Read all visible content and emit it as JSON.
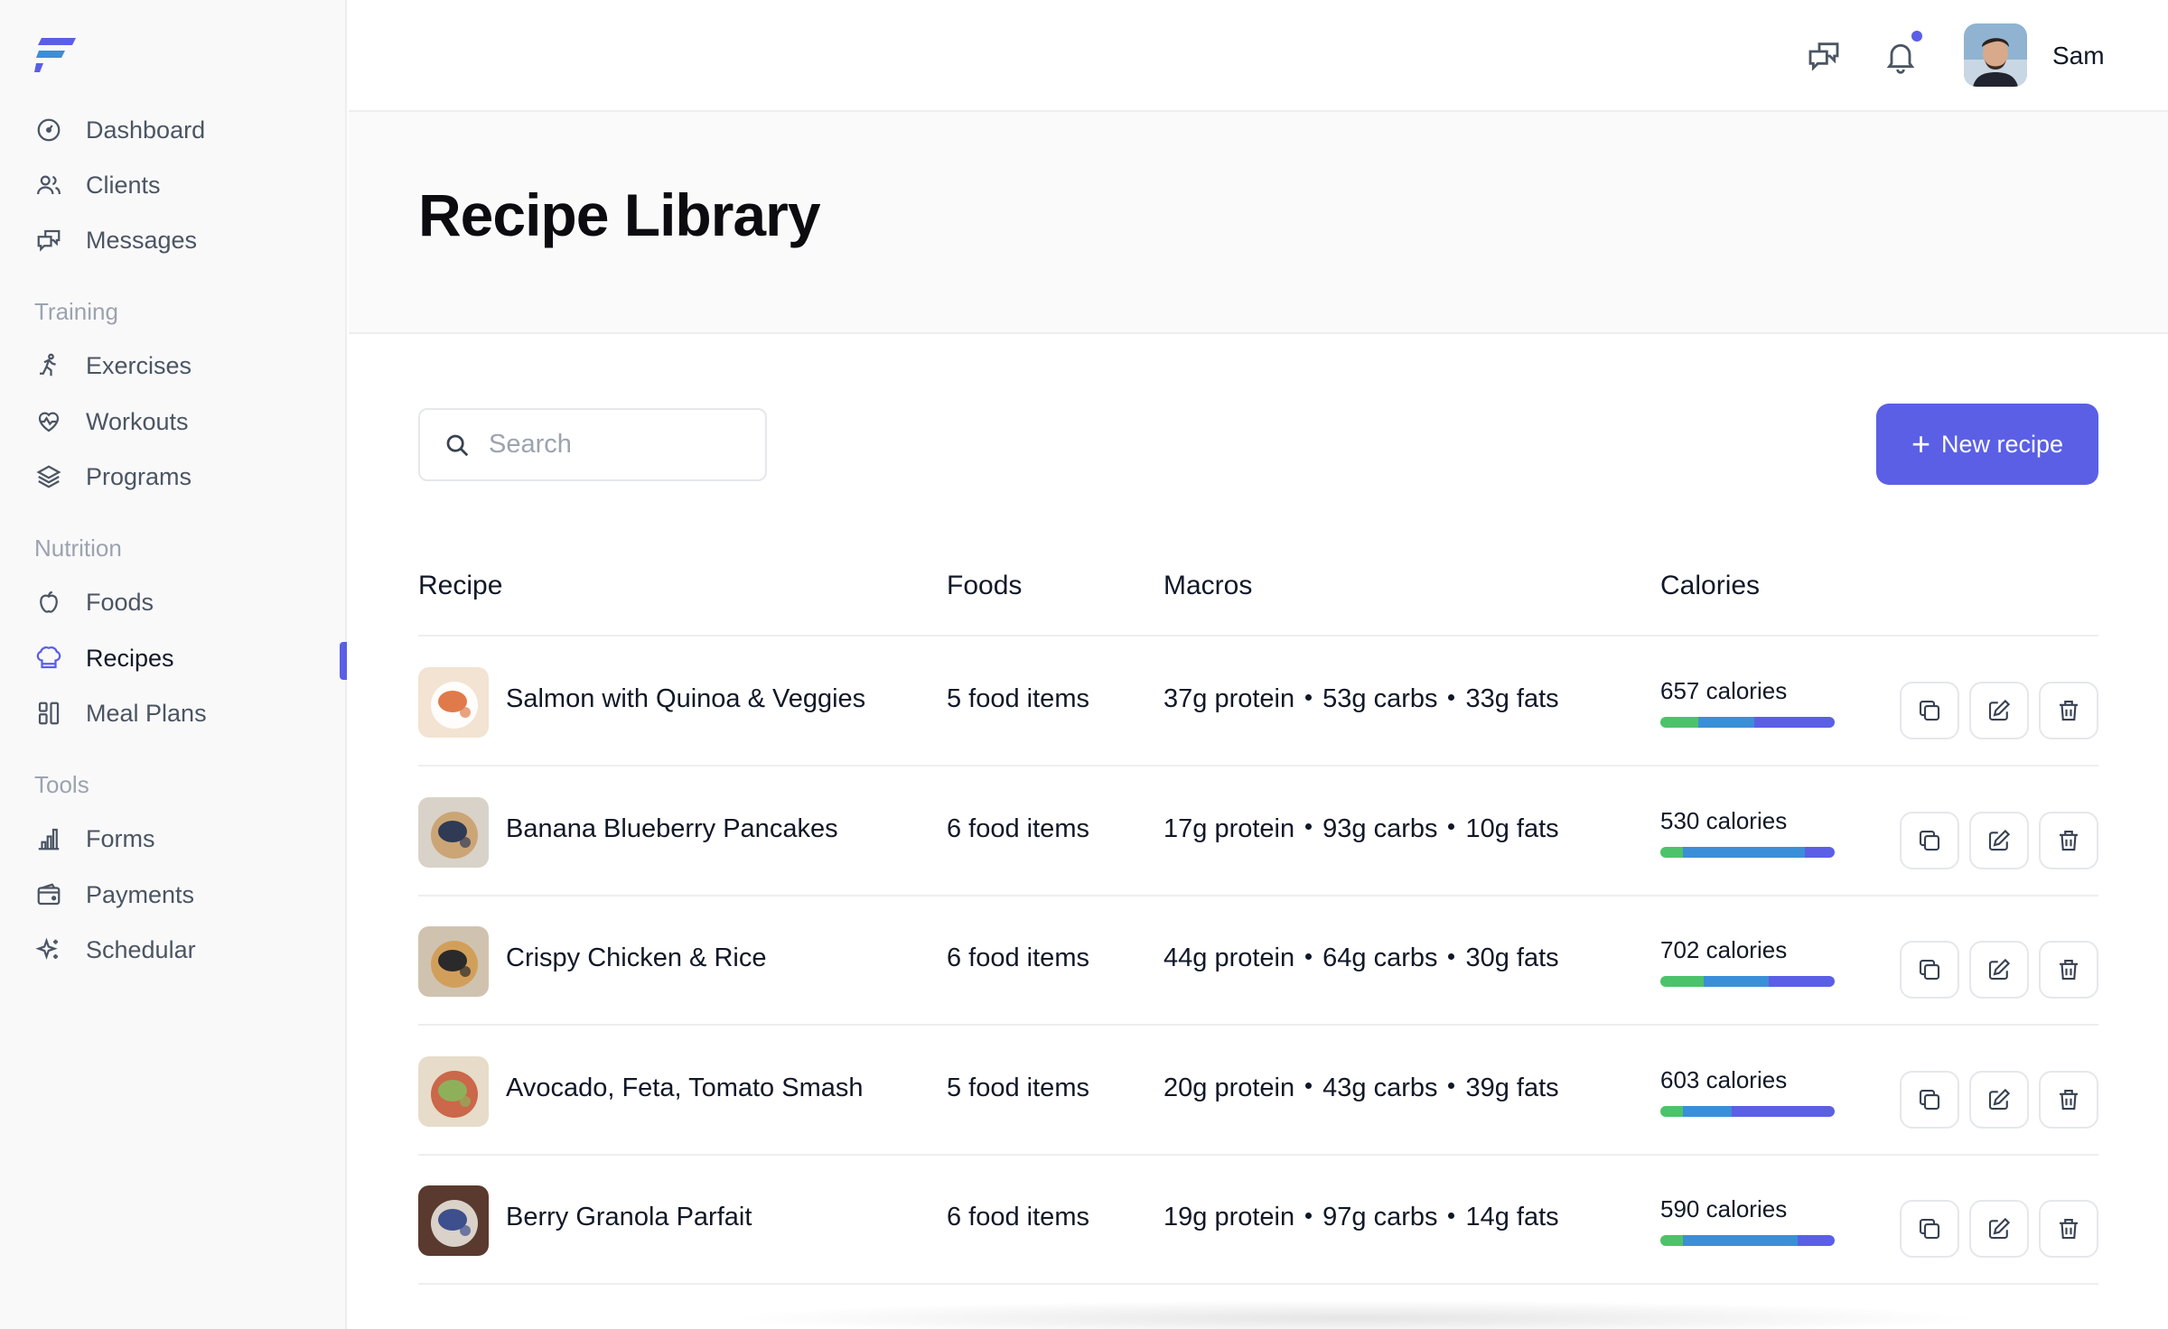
{
  "colors": {
    "accent": "#5a5fe6",
    "protein": "#4cc36a",
    "carbs": "#3b8fd8",
    "fats": "#5a5fe6"
  },
  "sidebar": {
    "logo": "logo-icon",
    "main_items": [
      {
        "label": "Dashboard",
        "icon": "dashboard-icon"
      },
      {
        "label": "Clients",
        "icon": "users-icon"
      },
      {
        "label": "Messages",
        "icon": "messages-icon"
      }
    ],
    "sections": [
      {
        "title": "Training",
        "items": [
          {
            "label": "Exercises",
            "icon": "running-icon"
          },
          {
            "label": "Workouts",
            "icon": "heart-pulse-icon"
          },
          {
            "label": "Programs",
            "icon": "layers-icon"
          }
        ]
      },
      {
        "title": "Nutrition",
        "items": [
          {
            "label": "Foods",
            "icon": "apple-icon"
          },
          {
            "label": "Recipes",
            "icon": "chef-hat-icon",
            "active": true
          },
          {
            "label": "Meal Plans",
            "icon": "grid-icon"
          }
        ]
      },
      {
        "title": "Tools",
        "items": [
          {
            "label": "Forms",
            "icon": "chart-icon"
          },
          {
            "label": "Payments",
            "icon": "wallet-icon"
          },
          {
            "label": "Schedular",
            "icon": "sparkle-icon"
          }
        ]
      }
    ]
  },
  "topbar": {
    "user_name": "Sam"
  },
  "page": {
    "title": "Recipe Library",
    "search_placeholder": "Search",
    "new_button_label": "New recipe"
  },
  "table": {
    "headers": {
      "recipe": "Recipe",
      "foods": "Foods",
      "macros": "Macros",
      "calories": "Calories"
    },
    "rows": [
      {
        "name": "Salmon with Quinoa & Veggies",
        "foods": "5 food items",
        "protein": "37g protein",
        "carbs": "53g carbs",
        "fats": "33g fats",
        "calories": "657 calories",
        "split": [
          0.22,
          0.32,
          0.46
        ],
        "thumb": [
          "#f3e3d2",
          "#e07a4a",
          "#ffffff"
        ]
      },
      {
        "name": "Banana Blueberry Pancakes",
        "foods": "6 food items",
        "protein": "17g protein",
        "carbs": "93g carbs",
        "fats": "10g fats",
        "calories": "530 calories",
        "split": [
          0.13,
          0.7,
          0.17
        ],
        "thumb": [
          "#d9d2c8",
          "#2f3a55",
          "#c9a06b"
        ]
      },
      {
        "name": "Crispy Chicken & Rice",
        "foods": "6 food items",
        "protein": "44g protein",
        "carbs": "64g carbs",
        "fats": "30g fats",
        "calories": "702 calories",
        "split": [
          0.25,
          0.37,
          0.38
        ],
        "thumb": [
          "#cfc3b0",
          "#2a2a2a",
          "#d29b52"
        ]
      },
      {
        "name": "Avocado, Feta, Tomato Smash",
        "foods": "5 food items",
        "protein": "20g protein",
        "carbs": "43g carbs",
        "fats": "39g fats",
        "calories": "603 calories",
        "split": [
          0.13,
          0.28,
          0.59
        ],
        "thumb": [
          "#e6dcc9",
          "#8fb05a",
          "#c85a3c"
        ]
      },
      {
        "name": "Berry Granola Parfait",
        "foods": "6 food items",
        "protein": "19g protein",
        "carbs": "97g carbs",
        "fats": "14g fats",
        "calories": "590 calories",
        "split": [
          0.13,
          0.66,
          0.21
        ],
        "thumb": [
          "#5a3a2e",
          "#3d4f8c",
          "#e8e2da"
        ]
      }
    ]
  }
}
